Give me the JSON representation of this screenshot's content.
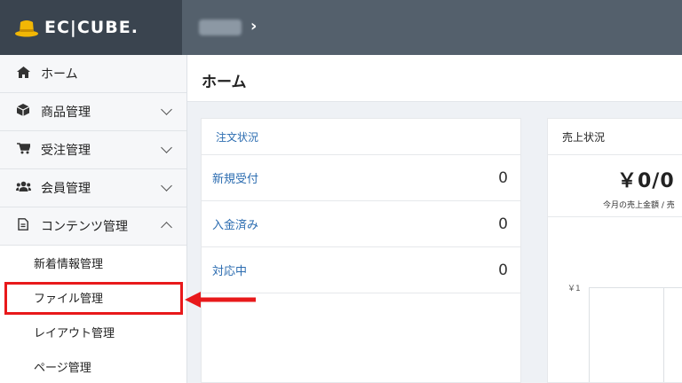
{
  "header": {
    "logo_text": "EC|CUBE."
  },
  "sidebar": {
    "items": [
      {
        "label": "ホーム",
        "icon": "home-icon",
        "chevron": "none"
      },
      {
        "label": "商品管理",
        "icon": "cube-icon",
        "chevron": "down"
      },
      {
        "label": "受注管理",
        "icon": "cart-icon",
        "chevron": "down"
      },
      {
        "label": "会員管理",
        "icon": "users-icon",
        "chevron": "down"
      },
      {
        "label": "コンテンツ管理",
        "icon": "file-icon",
        "chevron": "up"
      }
    ],
    "subitems": [
      {
        "label": "新着情報管理"
      },
      {
        "label": "ファイル管理"
      },
      {
        "label": "レイアウト管理"
      },
      {
        "label": "ページ管理"
      }
    ]
  },
  "main": {
    "title": "ホーム",
    "order_card": {
      "title": "注文状況",
      "rows": [
        {
          "label": "新規受付",
          "value": "0"
        },
        {
          "label": "入金済み",
          "value": "0"
        },
        {
          "label": "対応中",
          "value": "0"
        }
      ]
    },
    "sales_card": {
      "title": "売上状況",
      "amount": "￥0/0",
      "caption": "今月の売上金額 / 売",
      "y_tick": "￥1"
    }
  },
  "colors": {
    "header_bg": "#54606c",
    "logo_bg": "#3a444f",
    "link_blue": "#2b6cb0",
    "highlight_red": "#e8191b",
    "logo_gold": "#f2b705"
  }
}
